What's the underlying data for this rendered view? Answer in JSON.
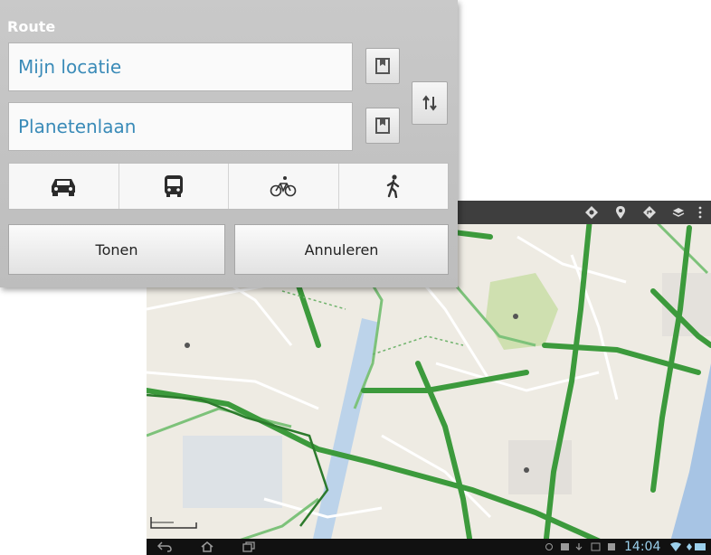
{
  "route_dialog": {
    "title": "Route",
    "from_value": "Mijn locatie",
    "to_value": "Planetenlaan",
    "modes": [
      {
        "icon": "car-icon"
      },
      {
        "icon": "bus-icon"
      },
      {
        "icon": "bicycle-icon"
      },
      {
        "icon": "walking-icon"
      }
    ],
    "show_label": "Tonen",
    "cancel_label": "Annuleren"
  },
  "map": {
    "action_icons": [
      "layers-icon",
      "pin-icon",
      "directions-icon",
      "stack-icon",
      "menu-icon"
    ],
    "status": {
      "time": "14:04"
    },
    "colors": {
      "road": "#3c9a3c",
      "road_light": "#7dc27a",
      "water": "#a7c4e4",
      "park": "#cfe0b0",
      "land": "#eeebe3"
    }
  }
}
